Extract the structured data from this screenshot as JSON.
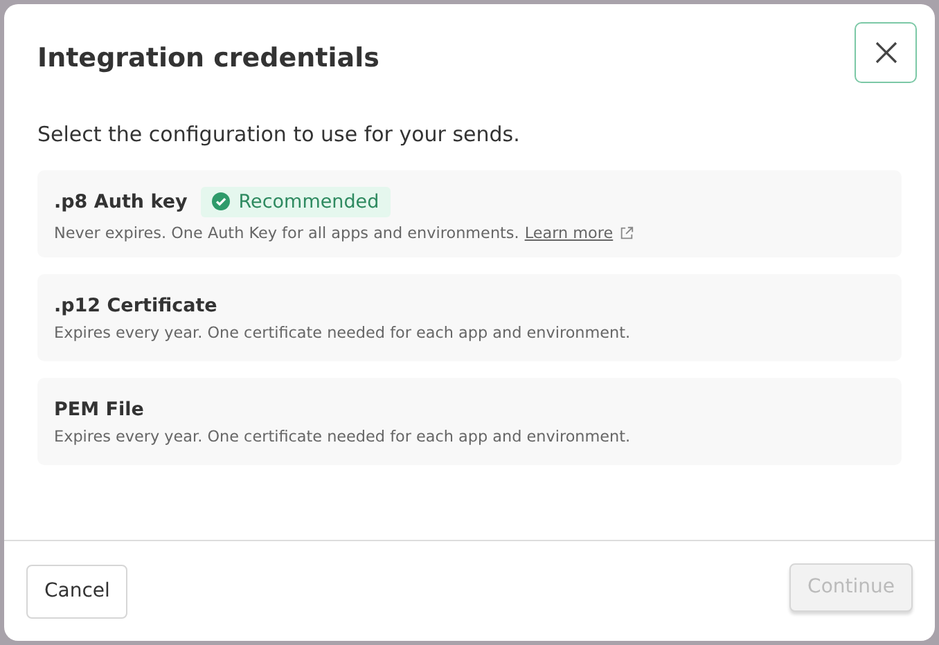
{
  "dialog": {
    "title": "Integration credentials",
    "subtitle": "Select the configuration to use for your sends.",
    "options": [
      {
        "title": ".p8 Auth key",
        "badge": "Recommended",
        "description": "Never expires. One Auth Key for all apps and environments.",
        "link": "Learn more"
      },
      {
        "title": ".p12 Certificate",
        "description": "Expires every year. One certificate needed for each app and environment."
      },
      {
        "title": "PEM File",
        "description": "Expires every year. One certificate needed for each app and environment."
      }
    ],
    "buttons": [
      {
        "label": "Cancel",
        "kind": "secondary",
        "disabled": false
      },
      {
        "label": "Continue",
        "kind": "primary",
        "disabled": true
      }
    ]
  }
}
